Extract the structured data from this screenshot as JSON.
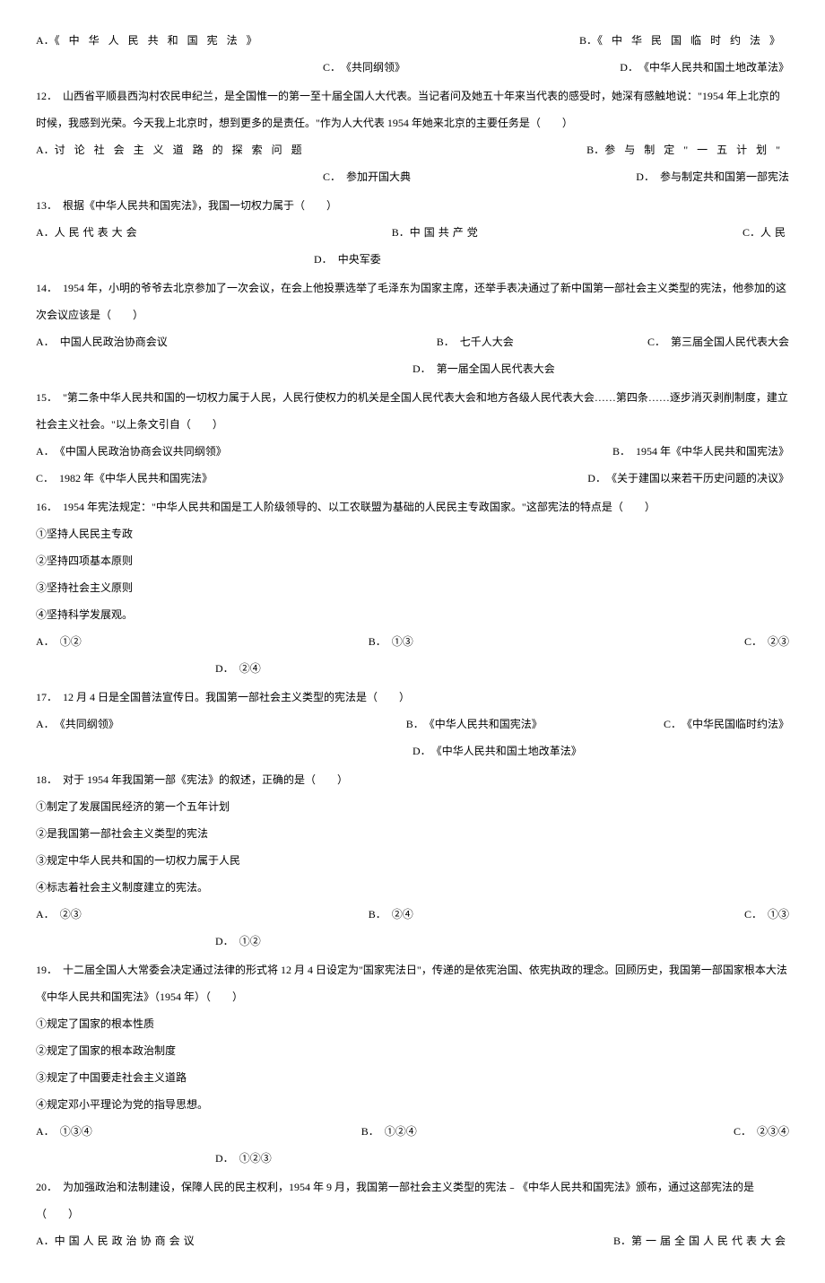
{
  "q11": {
    "optA_label": "A．",
    "optA_text": "《中华人民共和国宪法》",
    "optB_label": "B．",
    "optB_text": "《中华民国临时约法》",
    "optC_label": "C．",
    "optC_text": "《共同纲领》",
    "optD_label": "D．",
    "optD_text": "《中华人民共和国土地改革法》"
  },
  "q12": {
    "num": "12．",
    "text": "山西省平顺县西沟村农民申纪兰，是全国惟一的第一至十届全国人大代表。当记者问及她五十年来当代表的感受时，她深有感触地说：\"1954 年上北京的时候，我感到光荣。今天我上北京时，想到更多的是责任。\"作为人大代表 1954 年她来北京的主要任务是（　　）",
    "optA_label": "A．",
    "optA_text": "讨论社会主义道路的探索问题",
    "optB_label": "B．",
    "optB_text": "参与制定\"一五计划\"",
    "optC_label": "C．",
    "optC_text": "参加开国大典",
    "optD_label": "D．",
    "optD_text": "参与制定共和国第一部宪法"
  },
  "q13": {
    "num": "13．",
    "text": "根据《中华人民共和国宪法》，我国一切权力属于（　　）",
    "optA_label": "A．",
    "optA_text": "人民代表大会",
    "optB_label": "B．",
    "optB_text": "中国共产党",
    "optC_label": "C．",
    "optC_text": "人民",
    "optD_label": "D．",
    "optD_text": "中央军委"
  },
  "q14": {
    "num": "14．",
    "text": "1954 年，小明的爷爷去北京参加了一次会议，在会上他投票选举了毛泽东为国家主席，还举手表决通过了新中国第一部社会主义类型的宪法，他参加的这次会议应该是（　　）",
    "optA_label": "A．",
    "optA_text": "中国人民政治协商会议",
    "optB_label": "B．",
    "optB_text": "七千人大会",
    "optC_label": "C．",
    "optC_text": "第三届全国人民代表大会",
    "optD_label": "D．",
    "optD_text": "第一届全国人民代表大会"
  },
  "q15": {
    "num": "15．",
    "text": "\"第二条中华人民共和国的一切权力属于人民，人民行使权力的机关是全国人民代表大会和地方各级人民代表大会……第四条……逐步消灭剥削制度，建立社会主义社会。\"以上条文引自（　　）",
    "optA_label": "A．",
    "optA_text": "《中国人民政治协商会议共同纲领》",
    "optB_label": "B．",
    "optB_text": "1954 年《中华人民共和国宪法》",
    "optC_label": "C．",
    "optC_text": "1982 年《中华人民共和国宪法》",
    "optD_label": "D．",
    "optD_text": "《关于建国以来若干历史问题的决议》"
  },
  "q16": {
    "num": "16．",
    "text": "1954 年宪法规定：\"中华人民共和国是工人阶级领导的、以工农联盟为基础的人民民主专政国家。\"这部宪法的特点是（　　）",
    "s1": "①坚持人民民主专政",
    "s2": "②坚持四项基本原则",
    "s3": "③坚持社会主义原则",
    "s4": "④坚持科学发展观。",
    "optA_label": "A．",
    "optA_text": "①②",
    "optB_label": "B．",
    "optB_text": "①③",
    "optC_label": "C．",
    "optC_text": "②③",
    "optD_label": "D．",
    "optD_text": "②④"
  },
  "q17": {
    "num": "17．",
    "text": "12 月 4 日是全国普法宣传日。我国第一部社会主义类型的宪法是（　　）",
    "optA_label": "A．",
    "optA_text": "《共同纲领》",
    "optB_label": "B．",
    "optB_text": "《中华人民共和国宪法》",
    "optC_label": "C．",
    "optC_text": "《中华民国临时约法》",
    "optD_label": "D．",
    "optD_text": "《中华人民共和国土地改革法》"
  },
  "q18": {
    "num": "18．",
    "text": "对于 1954 年我国第一部《宪法》的叙述，正确的是（　　）",
    "s1": "①制定了发展国民经济的第一个五年计划",
    "s2": "②是我国第一部社会主义类型的宪法",
    "s3": "③规定中华人民共和国的一切权力属于人民",
    "s4": "④标志着社会主义制度建立的宪法。",
    "optA_label": "A．",
    "optA_text": "②③",
    "optB_label": "B．",
    "optB_text": "②④",
    "optC_label": "C．",
    "optC_text": "①③",
    "optD_label": "D．",
    "optD_text": "①②"
  },
  "q19": {
    "num": "19．",
    "text": "十二届全国人大常委会决定通过法律的形式将 12 月 4 日设定为\"国家宪法日\"，传递的是依宪治国、依宪执政的理念。回顾历史，我国第一部国家根本大法《中华人民共和国宪法》（1954 年）（　　）",
    "s1": "①规定了国家的根本性质",
    "s2": "②规定了国家的根本政治制度",
    "s3": "③规定了中国要走社会主义道路",
    "s4": "④规定邓小平理论为党的指导思想。",
    "optA_label": "A．",
    "optA_text": "①③④",
    "optB_label": "B．",
    "optB_text": "①②④",
    "optC_label": "C．",
    "optC_text": "②③④",
    "optD_label": "D．",
    "optD_text": "①②③"
  },
  "q20": {
    "num": "20．",
    "text": "为加强政治和法制建设，保障人民的民主权利，1954 年 9 月，我国第一部社会主义类型的宪法﹣《中华人民共和国宪法》颁布，通过这部宪法的是（　　）",
    "optA_label": "A．",
    "optA_text": "中国人民政治协商会议",
    "optB_label": "B．",
    "optB_text": "第一届全国人民代表大会"
  }
}
